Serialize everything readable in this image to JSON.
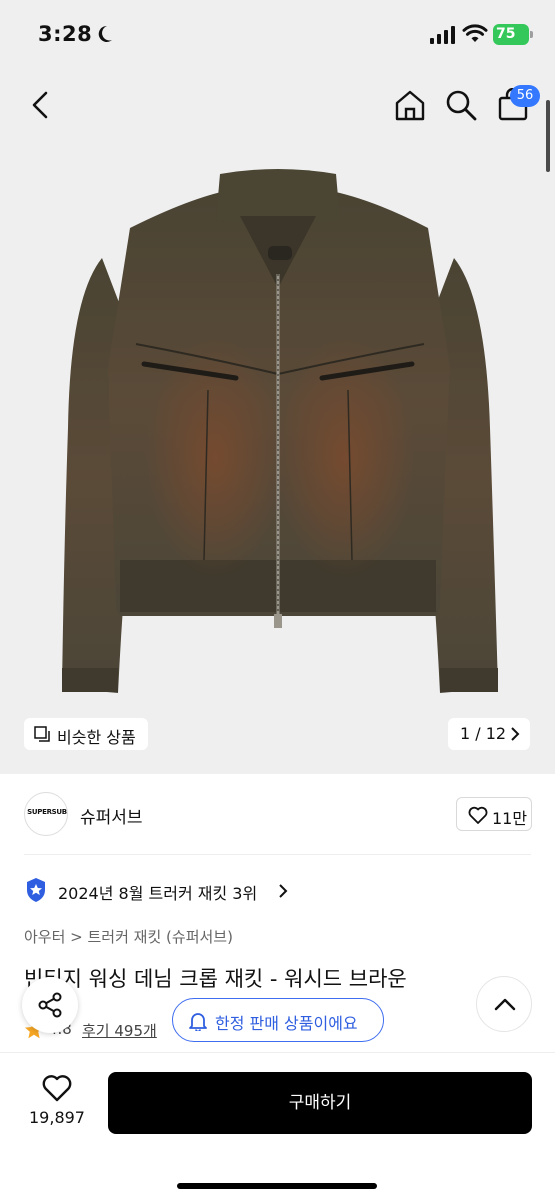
{
  "status_bar": {
    "time": "3:28",
    "battery": "75"
  },
  "nav": {
    "cart_count": "56"
  },
  "gallery": {
    "similar_label": "비슷한 상품",
    "page_indicator": "1 / 12"
  },
  "brand": {
    "name": "슈퍼서브",
    "logo_text": "SUPERSUB",
    "like_count": "11만"
  },
  "ranking": {
    "text": "2024년 8월 트러커 재킷 3위"
  },
  "breadcrumb": "아우터 > 트러커 재킷 (슈퍼서브)",
  "product": {
    "title": "빈티지 워싱 데님 크롭 재킷 - 워시드 브라운",
    "rating": "4.8",
    "review_text": "후기 495개"
  },
  "limited_notice": "한정 판매 상품이에요",
  "bottom_bar": {
    "favorite_count": "19,897",
    "buy_label": "구매하기"
  },
  "colors": {
    "accent_blue": "#3378ff",
    "battery_green": "#34c759",
    "rank_blue": "#2f5fe0"
  }
}
